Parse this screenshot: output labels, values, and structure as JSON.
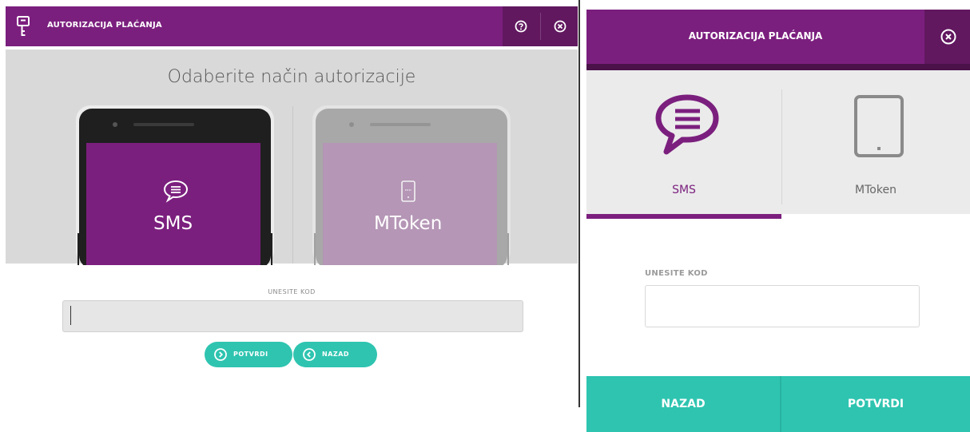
{
  "left": {
    "title": "AUTORIZACIJA PLAĆANJA",
    "subtitle": "Odaberite način autorizacije",
    "options": [
      {
        "label": "SMS",
        "icon": "chat-bubble-icon",
        "state": "selected"
      },
      {
        "label": "MToken",
        "icon": "tablet-icon",
        "state": "disabled"
      }
    ],
    "code_label": "UNESITE KOD",
    "code_value": "",
    "confirm_label": "POTVRDI",
    "back_label": "NAZAD"
  },
  "right": {
    "title": "AUTORIZACIJA PLAĆANJA",
    "tabs": [
      {
        "label": "SMS",
        "icon": "chat-bubble-icon",
        "active": true
      },
      {
        "label": "MToken",
        "icon": "tablet-icon",
        "active": false
      }
    ],
    "code_label": "UNESITE KOD",
    "code_value": "",
    "back_label": "NAZAD",
    "confirm_label": "POTVRDI"
  },
  "colors": {
    "brand_purple": "#7b1f7e",
    "dark_purple": "#61185f",
    "teal": "#2ec4b0",
    "hero_gray": "#d9d9d9"
  }
}
